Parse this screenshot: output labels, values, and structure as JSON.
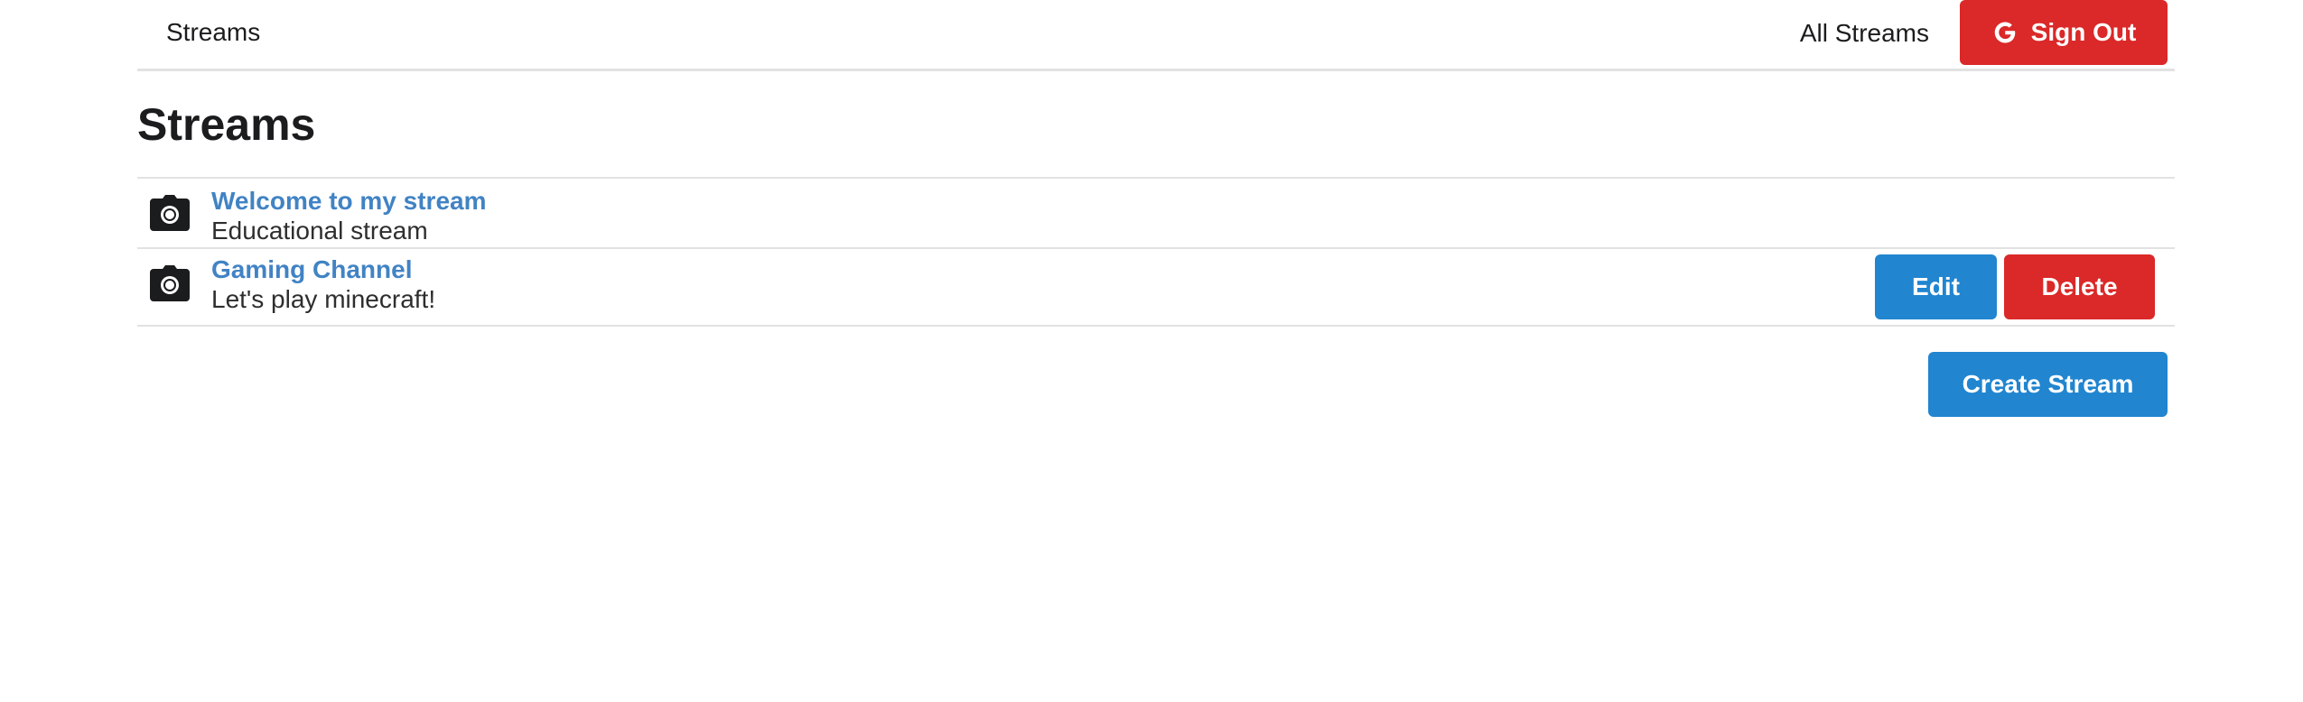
{
  "menu": {
    "home_label": "Streams",
    "all_streams_label": "All Streams",
    "sign_out_label": "Sign Out",
    "sign_out_icon": "google-icon"
  },
  "page": {
    "title": "Streams"
  },
  "streams": [
    {
      "title": "Welcome to my stream",
      "description": "Educational stream",
      "icon": "camera-icon"
    },
    {
      "title": "Gaming Channel",
      "description": "Let's play minecraft!",
      "icon": "camera-icon",
      "edit_label": "Edit",
      "delete_label": "Delete"
    }
  ],
  "actions": {
    "create_label": "Create Stream"
  },
  "colors": {
    "primary": "#2185d0",
    "danger": "#db2828",
    "link": "#4183c4",
    "divider": "#e2e2e2"
  }
}
